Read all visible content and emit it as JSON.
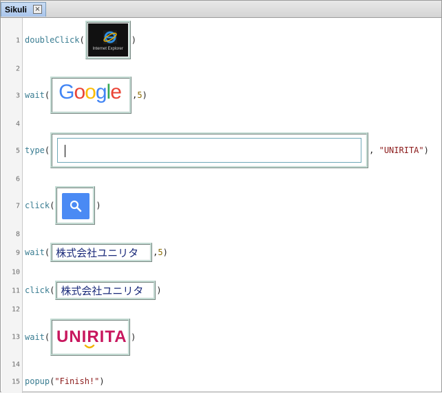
{
  "tab": {
    "title": "Sikuli",
    "close_symbol": "×"
  },
  "lines": [
    {
      "n": "1"
    },
    {
      "n": "2"
    },
    {
      "n": "3"
    },
    {
      "n": "4"
    },
    {
      "n": "5"
    },
    {
      "n": "6"
    },
    {
      "n": "7"
    },
    {
      "n": "8"
    },
    {
      "n": "9"
    },
    {
      "n": "10"
    },
    {
      "n": "11"
    },
    {
      "n": "12"
    },
    {
      "n": "13"
    },
    {
      "n": "14"
    },
    {
      "n": "15"
    }
  ],
  "code": {
    "l1": {
      "fn": "doubleClick",
      "open": "(",
      "close": ")"
    },
    "l3": {
      "fn": "wait",
      "open": "(",
      "sep": ",",
      "timeout": "5",
      "close": ")"
    },
    "l5": {
      "fn": "type",
      "open": "(",
      "sep": ", ",
      "text": "\"UNIRITA\"",
      "close": ")"
    },
    "l7": {
      "fn": "click",
      "open": "(",
      "close": ")"
    },
    "l9": {
      "fn": "wait",
      "open": "(",
      "sep": ",",
      "timeout": "5",
      "close": ")"
    },
    "l11": {
      "fn": "click",
      "open": "(",
      "close": ")"
    },
    "l13": {
      "fn": "wait",
      "open": "(",
      "close": ")"
    },
    "l15": {
      "fn": "popup",
      "open": "(",
      "text": "\"Finish!\"",
      "close": ")"
    }
  },
  "images": {
    "ie": {
      "caption": "Internet Explorer",
      "icon": "internet-explorer-icon"
    },
    "google": {
      "g1": "G",
      "o1": "o",
      "o2": "o",
      "g2": "g",
      "l": "l",
      "e": "e",
      "sub": "ja"
    },
    "search": {
      "icon": "magnifier-icon",
      "color": "#4a8af4"
    },
    "company_name": "株式会社ユニリタ",
    "unirita": {
      "logo_text": "UNIRITA",
      "color": "#c8175e"
    }
  }
}
